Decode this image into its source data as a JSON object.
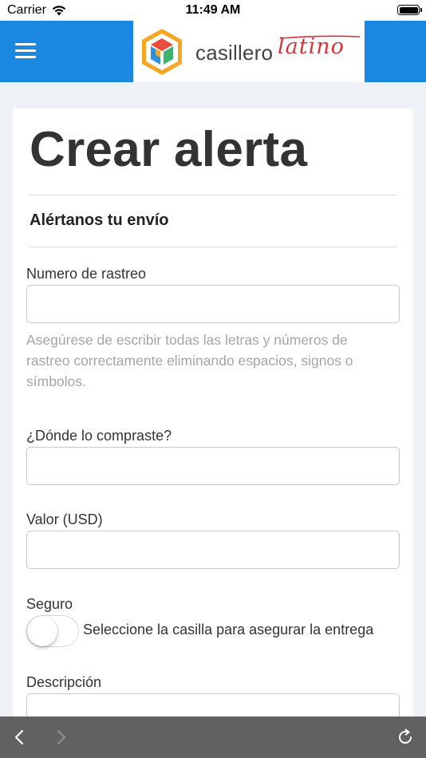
{
  "status_bar": {
    "carrier": "Carrier",
    "time": "11:49 AM",
    "wifi_icon": "wifi-icon",
    "battery_icon": "battery-icon"
  },
  "header": {
    "menu_icon": "hamburger-menu-icon",
    "logo_word_1": "casillero",
    "logo_word_2": "latino",
    "background_color": "#1a88e1"
  },
  "page": {
    "title": "Crear alerta",
    "section_title": "Alértanos tu envío"
  },
  "form": {
    "tracking_label": "Numero de rastreo",
    "tracking_value": "",
    "tracking_help": "Asegúrese de escribir todas las letras y números de rastreo correctamente eliminando espacios, signos o símbolos.",
    "store_label": "¿Dónde lo compraste?",
    "store_value": "",
    "value_label": "Valor (USD)",
    "value_value": "",
    "insurance_label": "Seguro",
    "insurance_toggle_on": false,
    "insurance_toggle_text": "Seleccione la casilla para asegurar la entrega",
    "description_label": "Descripción",
    "description_value": ""
  },
  "browser_bar": {
    "back_icon": "chevron-left-icon",
    "forward_icon": "chevron-right-icon",
    "reload_icon": "reload-icon"
  }
}
